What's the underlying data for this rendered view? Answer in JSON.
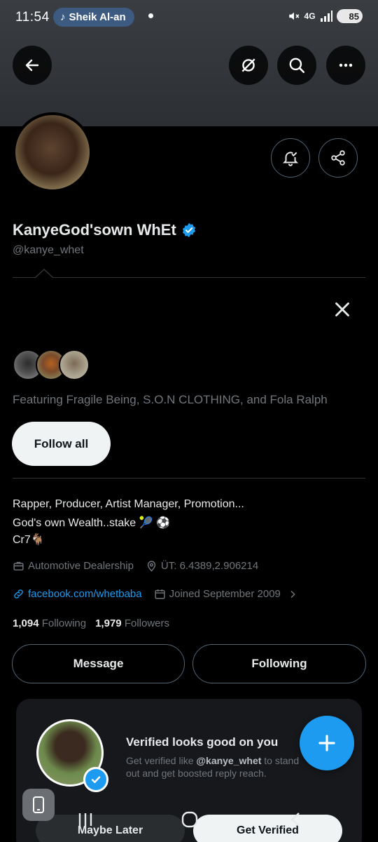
{
  "status_bar": {
    "time": "11:54",
    "notification_pill": "Sheik Al-an",
    "network": "4G",
    "battery": "85",
    "icons": [
      "tiktok-icon",
      "mute-icon",
      "signal-icon",
      "battery-icon"
    ]
  },
  "header": {
    "icons": [
      "back-arrow-icon",
      "grok-icon",
      "search-icon",
      "more-icon"
    ]
  },
  "profile": {
    "display_name": "KanyeGod'sown WhEt",
    "handle": "@kanye_whet",
    "verified": true,
    "bio_lines": [
      "Rapper, Producer, Artist Manager, Promotion...",
      "God's own Wealth..stake 🎾 ⚽",
      "Cr7🐐"
    ],
    "category": "Automotive Dealership",
    "location": "ÜT: 6.4389,2.906214",
    "website": "facebook.com/whetbaba",
    "joined": "Joined September 2009",
    "following_count": "1,094",
    "following_label": "Following",
    "followers_count": "1,979",
    "followers_label": "Followers"
  },
  "suggestions": {
    "featuring_text": "Featuring Fragile Being, S.O.N CLOTHING, and Fola Ralph",
    "follow_all_label": "Follow all"
  },
  "actions": {
    "message_label": "Message",
    "following_label": "Following"
  },
  "verified_card": {
    "title": "Verified looks good on you",
    "subtitle_prefix": "Get verified like ",
    "subtitle_handle": "@kanye_whet",
    "subtitle_suffix": " to stand out and get boosted reply reach.",
    "maybe_later_label": "Maybe Later",
    "get_verified_label": "Get Verified"
  },
  "colors": {
    "accent": "#1d9bf0",
    "background": "#000000",
    "secondary_text": "#71767b"
  }
}
